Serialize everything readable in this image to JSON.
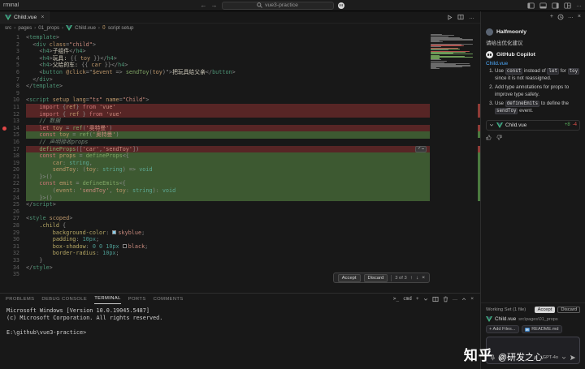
{
  "icons": {
    "close": "×",
    "plus": "+",
    "ellipsis": "…",
    "arrow_up": "↑",
    "arrow_down": "↓",
    "check": "✓",
    "back": "←",
    "forward": "→",
    "braces": "{}",
    "markdown": "M",
    "shell_prompt": ">_"
  },
  "titlebar": {
    "menu_partial": "rminal",
    "search_title": "vue3-practice"
  },
  "tabbar": {
    "tabs": [
      {
        "label": "Child.vue"
      }
    ]
  },
  "breadcrumb": {
    "separator": "›",
    "items": [
      "src",
      "pages",
      "01_props",
      "Child.vue",
      "script setup"
    ]
  },
  "editor": {
    "accept_label": "Accept",
    "discard_label": "Discard",
    "inline_widget_counter": "3 of 3",
    "lines": [
      {
        "n": 1,
        "t": [
          [
            "p",
            "<"
          ],
          [
            "g",
            "template"
          ],
          [
            "p",
            ">"
          ]
        ]
      },
      {
        "n": 2,
        "t": [
          [
            "t",
            "  "
          ],
          [
            "p",
            "<"
          ],
          [
            "g",
            "div"
          ],
          [
            "t",
            " "
          ],
          [
            "a",
            "class"
          ],
          [
            "p",
            "="
          ],
          [
            "s",
            "\"child\""
          ],
          [
            "p",
            ">"
          ]
        ]
      },
      {
        "n": 3,
        "t": [
          [
            "t",
            "    "
          ],
          [
            "p",
            "<"
          ],
          [
            "g",
            "h4"
          ],
          [
            "p",
            ">"
          ],
          [
            "t",
            "子组件"
          ],
          [
            "p",
            "</"
          ],
          [
            "g",
            "h4"
          ],
          [
            "p",
            ">"
          ]
        ]
      },
      {
        "n": 4,
        "t": [
          [
            "t",
            "    "
          ],
          [
            "p",
            "<"
          ],
          [
            "g",
            "h4"
          ],
          [
            "p",
            ">"
          ],
          [
            "t",
            "玩具: "
          ],
          [
            "p",
            "{{ "
          ],
          [
            "v",
            "toy"
          ],
          [
            "p",
            " }}"
          ],
          [
            "p",
            "</"
          ],
          [
            "g",
            "h4"
          ],
          [
            "p",
            ">"
          ]
        ]
      },
      {
        "n": 5,
        "t": [
          [
            "t",
            "    "
          ],
          [
            "p",
            "<"
          ],
          [
            "g",
            "h4"
          ],
          [
            "p",
            ">"
          ],
          [
            "t",
            "父给的车: "
          ],
          [
            "p",
            "{{ "
          ],
          [
            "v",
            "car"
          ],
          [
            "p",
            " }}"
          ],
          [
            "p",
            "</"
          ],
          [
            "g",
            "h4"
          ],
          [
            "p",
            ">"
          ]
        ]
      },
      {
        "n": 6,
        "t": [
          [
            "t",
            "    "
          ],
          [
            "p",
            "<"
          ],
          [
            "g",
            "button"
          ],
          [
            "t",
            " "
          ],
          [
            "a",
            "@click"
          ],
          [
            "p",
            "=\""
          ],
          [
            "v",
            "$event"
          ],
          [
            "p",
            " => "
          ],
          [
            "f",
            "sendToy"
          ],
          [
            "p",
            "("
          ],
          [
            "v",
            "toy"
          ],
          [
            "p",
            ")\">"
          ],
          [
            "t",
            "把玩具给父亲"
          ],
          [
            "p",
            "</"
          ],
          [
            "g",
            "button"
          ],
          [
            "p",
            ">"
          ]
        ]
      },
      {
        "n": 7,
        "t": [
          [
            "t",
            "  "
          ],
          [
            "p",
            "</"
          ],
          [
            "g",
            "div"
          ],
          [
            "p",
            ">"
          ]
        ]
      },
      {
        "n": 8,
        "t": [
          [
            "p",
            "</"
          ],
          [
            "g",
            "template"
          ],
          [
            "p",
            ">"
          ]
        ]
      },
      {
        "n": 9,
        "t": []
      },
      {
        "n": 10,
        "t": [
          [
            "p",
            "<"
          ],
          [
            "g",
            "script"
          ],
          [
            "t",
            " "
          ],
          [
            "a",
            "setup"
          ],
          [
            "t",
            " "
          ],
          [
            "a",
            "lang"
          ],
          [
            "p",
            "="
          ],
          [
            "s",
            "\"ts\""
          ],
          [
            "t",
            " "
          ],
          [
            "a",
            "name"
          ],
          [
            "p",
            "="
          ],
          [
            "s",
            "\"Child\""
          ],
          [
            "p",
            ">"
          ]
        ]
      },
      {
        "n": 11,
        "bg": "removed",
        "t": [
          [
            "t",
            "    "
          ],
          [
            "k",
            "import"
          ],
          [
            "p",
            " {"
          ],
          [
            "v",
            "ref"
          ],
          [
            "p",
            "} "
          ],
          [
            "k",
            "from"
          ],
          [
            "t",
            " "
          ],
          [
            "s",
            "'vue'"
          ]
        ]
      },
      {
        "n": 12,
        "bg": "removed",
        "t": [
          [
            "t",
            "    "
          ],
          [
            "k",
            "import"
          ],
          [
            "p",
            " { "
          ],
          [
            "v",
            "ref"
          ],
          [
            "p",
            " } "
          ],
          [
            "k",
            "from"
          ],
          [
            "t",
            " "
          ],
          [
            "s",
            "'vue'"
          ]
        ]
      },
      {
        "n": 13,
        "t": [
          [
            "t",
            "    "
          ],
          [
            "c",
            "// 数据"
          ]
        ]
      },
      {
        "n": 14,
        "bg": "removed",
        "dot": true,
        "t": [
          [
            "t",
            "    "
          ],
          [
            "k",
            "let"
          ],
          [
            "t",
            " "
          ],
          [
            "v",
            "toy"
          ],
          [
            "p",
            " = "
          ],
          [
            "f",
            "ref"
          ],
          [
            "p",
            "("
          ],
          [
            "s",
            "'奥特曼'"
          ],
          [
            "p",
            ")"
          ]
        ]
      },
      {
        "n": 15,
        "bg": "added",
        "t": [
          [
            "t",
            "    "
          ],
          [
            "k",
            "const"
          ],
          [
            "t",
            " "
          ],
          [
            "v",
            "toy"
          ],
          [
            "p",
            " = "
          ],
          [
            "f",
            "ref"
          ],
          [
            "p",
            "("
          ],
          [
            "s",
            "'奥特曼'"
          ],
          [
            "p",
            ")"
          ]
        ]
      },
      {
        "n": 16,
        "t": [
          [
            "t",
            "    "
          ],
          [
            "c",
            "// 声明接收props"
          ]
        ]
      },
      {
        "n": 17,
        "bg": "removed",
        "widget": true,
        "t": [
          [
            "t",
            "    "
          ],
          [
            "f",
            "defineProps"
          ],
          [
            "p",
            "(["
          ],
          [
            "s",
            "'car'"
          ],
          [
            "p",
            ","
          ],
          [
            "s",
            "'sendToy'"
          ],
          [
            "p",
            "])"
          ]
        ]
      },
      {
        "n": 18,
        "bg": "added",
        "t": [
          [
            "t",
            "    "
          ],
          [
            "k",
            "const"
          ],
          [
            "t",
            " "
          ],
          [
            "v",
            "props"
          ],
          [
            "p",
            " = "
          ],
          [
            "f",
            "defineProps"
          ],
          [
            "p",
            "<{"
          ]
        ]
      },
      {
        "n": 19,
        "bg": "added",
        "t": [
          [
            "t",
            "        "
          ],
          [
            "v",
            "car"
          ],
          [
            "p",
            ": "
          ],
          [
            "y",
            "string"
          ],
          [
            "p",
            ","
          ]
        ]
      },
      {
        "n": 20,
        "bg": "added",
        "t": [
          [
            "t",
            "        "
          ],
          [
            "v",
            "sendToy"
          ],
          [
            "p",
            ": ("
          ],
          [
            "v",
            "toy"
          ],
          [
            "p",
            ": "
          ],
          [
            "y",
            "string"
          ],
          [
            "p",
            ") => "
          ],
          [
            "y",
            "void"
          ]
        ]
      },
      {
        "n": 21,
        "bg": "added",
        "t": [
          [
            "t",
            "    "
          ],
          [
            "p",
            "}>()"
          ]
        ]
      },
      {
        "n": 22,
        "bg": "added",
        "t": [
          [
            "t",
            "    "
          ],
          [
            "k",
            "const"
          ],
          [
            "t",
            " "
          ],
          [
            "v",
            "emit"
          ],
          [
            "p",
            " = "
          ],
          [
            "f",
            "defineEmits"
          ],
          [
            "p",
            "<{"
          ]
        ]
      },
      {
        "n": 23,
        "bg": "added",
        "t": [
          [
            "t",
            "        "
          ],
          [
            "p",
            "("
          ],
          [
            "v",
            "event"
          ],
          [
            "p",
            ": "
          ],
          [
            "s",
            "'sendToy'"
          ],
          [
            "p",
            ", "
          ],
          [
            "v",
            "toy"
          ],
          [
            "p",
            ": "
          ],
          [
            "y",
            "string"
          ],
          [
            "p",
            "): "
          ],
          [
            "y",
            "void"
          ]
        ]
      },
      {
        "n": 24,
        "bg": "added",
        "t": [
          [
            "t",
            "    "
          ],
          [
            "p",
            "}>()"
          ]
        ]
      },
      {
        "n": 25,
        "t": [
          [
            "p",
            "</"
          ],
          [
            "g",
            "script"
          ],
          [
            "p",
            ">"
          ]
        ]
      },
      {
        "n": 26,
        "t": []
      },
      {
        "n": 27,
        "t": [
          [
            "p",
            "<"
          ],
          [
            "g",
            "style"
          ],
          [
            "t",
            " "
          ],
          [
            "a",
            "scoped"
          ],
          [
            "p",
            ">"
          ]
        ]
      },
      {
        "n": 28,
        "t": [
          [
            "t",
            "    "
          ],
          [
            "d",
            ".child"
          ],
          [
            "p",
            " {"
          ]
        ]
      },
      {
        "n": 29,
        "t": [
          [
            "t",
            "        "
          ],
          [
            "d",
            "background-color"
          ],
          [
            "p",
            ": "
          ],
          [
            "sw",
            "#87ceeb"
          ],
          [
            "s",
            "skyblue"
          ],
          [
            "p",
            ";"
          ]
        ]
      },
      {
        "n": 30,
        "t": [
          [
            "t",
            "        "
          ],
          [
            "d",
            "padding"
          ],
          [
            "p",
            ": "
          ],
          [
            "n",
            "10px"
          ],
          [
            "p",
            ";"
          ]
        ]
      },
      {
        "n": 31,
        "t": [
          [
            "t",
            "        "
          ],
          [
            "d",
            "box-shadow"
          ],
          [
            "p",
            ": "
          ],
          [
            "n",
            "0 0 10px "
          ],
          [
            "sw",
            "#000000"
          ],
          [
            "s",
            "black"
          ],
          [
            "p",
            ";"
          ]
        ]
      },
      {
        "n": 32,
        "t": [
          [
            "t",
            "        "
          ],
          [
            "d",
            "border-radius"
          ],
          [
            "p",
            ": "
          ],
          [
            "n",
            "10px"
          ],
          [
            "p",
            ";"
          ]
        ]
      },
      {
        "n": 33,
        "t": [
          [
            "t",
            "    "
          ],
          [
            "p",
            "}"
          ]
        ]
      },
      {
        "n": 34,
        "t": [
          [
            "p",
            "</"
          ],
          [
            "g",
            "style"
          ],
          [
            "p",
            ">"
          ]
        ]
      },
      {
        "n": 35,
        "t": []
      }
    ]
  },
  "panel": {
    "tabs": [
      {
        "label": "PROBLEMS"
      },
      {
        "label": "DEBUG CONSOLE"
      },
      {
        "label": "TERMINAL",
        "active": true
      },
      {
        "label": "PORTS"
      },
      {
        "label": "COMMENTS"
      }
    ],
    "shell_label": "cmd",
    "terminal_lines": [
      "Microsoft Windows [Version 10.0.19045.5487]",
      "(c) Microsoft Corporation. All rights reserved.",
      "",
      "E:\\github\\vue3-practice>"
    ]
  },
  "copilot": {
    "user": {
      "name": "Halfmoonly",
      "message": "请给出优化建议"
    },
    "assistant": {
      "name": "GitHub Copilot",
      "file_link": "Child.vue",
      "suggestions": [
        {
          "segments": [
            {
              "t": "Use "
            },
            {
              "t": "const",
              "code": true
            },
            {
              "t": " instead of "
            },
            {
              "t": "let",
              "code": true
            },
            {
              "t": " for "
            },
            {
              "t": "toy",
              "code": true
            },
            {
              "t": " since it is not reassigned."
            }
          ]
        },
        {
          "segments": [
            {
              "t": "Add type annotations for props to improve type safety."
            }
          ]
        },
        {
          "segments": [
            {
              "t": "Use "
            },
            {
              "t": "defineEmits",
              "code": true
            },
            {
              "t": " to define the "
            },
            {
              "t": "sendToy",
              "code": true
            },
            {
              "t": " event."
            }
          ]
        }
      ],
      "changed_file": {
        "name": "Child.vue",
        "added": "+8",
        "removed": "-4"
      }
    },
    "working_set": {
      "label": "Working Set (1 file)",
      "accept": "Accept",
      "discard": "Discard",
      "file": "Child.vue",
      "path": "src\\pages\\01_props"
    },
    "chips": [
      {
        "label": "+ Add Files..."
      },
      {
        "label": "README.md",
        "icon": "markdown"
      }
    ],
    "input": {
      "model": "GPT-4o"
    }
  },
  "watermark": {
    "brand": "知乎",
    "handle": "@研发之心"
  },
  "colors": {
    "added_bg": "#3d5931",
    "removed_bg": "#572525",
    "accent": "#4daafc",
    "vue_green": "#41b883"
  }
}
